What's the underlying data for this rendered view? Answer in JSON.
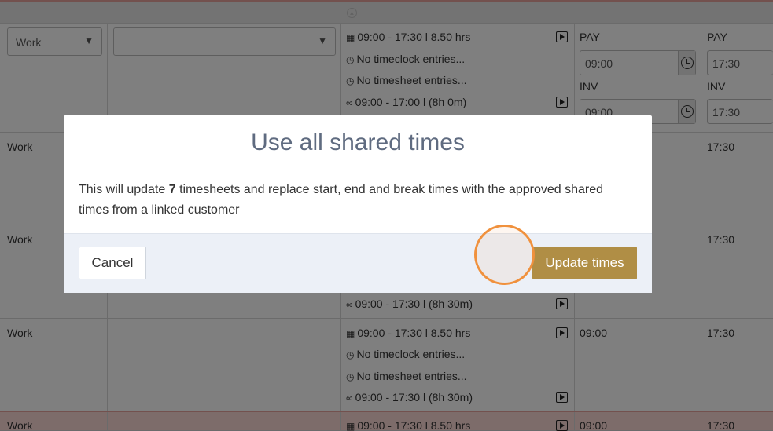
{
  "background": {
    "rows": [
      {
        "type": "Work",
        "scheduled": "09:00 - 17:30 l 8.50 hrs",
        "timeclock": "No timeclock entries...",
        "timesheet": "No timesheet entries...",
        "shared": "09:00 - 17:00 l (8h 0m)",
        "pay_label": "PAY",
        "inv_label": "INV",
        "pay_start": "09:00",
        "inv_start": "09:00",
        "pay_end": "17:30",
        "inv_end": "17:30"
      },
      {
        "type": "Work",
        "end": "17:30"
      },
      {
        "type": "Work",
        "end": "17:30",
        "shared": "09:00 - 17:30 l (8h 30m)"
      },
      {
        "type": "Work",
        "scheduled": "09:00 - 17:30 l 8.50 hrs",
        "timeclock": "No timeclock entries...",
        "timesheet": "No timesheet entries...",
        "shared": "09:00 - 17:30 l (8h 30m)",
        "start": "09:00",
        "end": "17:30"
      },
      {
        "type": "Work",
        "scheduled": "09:00 - 17:30 l 8.50 hrs",
        "start": "09:00",
        "end": "17:30"
      }
    ]
  },
  "modal": {
    "title": "Use all shared times",
    "body_prefix": "This will update ",
    "body_count": "7",
    "body_suffix": " timesheets and replace start, end and break times with the approved shared times from a linked customer",
    "cancel_label": "Cancel",
    "update_label": "Update times"
  },
  "colors": {
    "accent": "#b08e45",
    "title": "#5f6b80",
    "footer_bg": "#ecf0f7",
    "highlight_row": "#fbd8d5",
    "click_marker": "#f0913d"
  }
}
